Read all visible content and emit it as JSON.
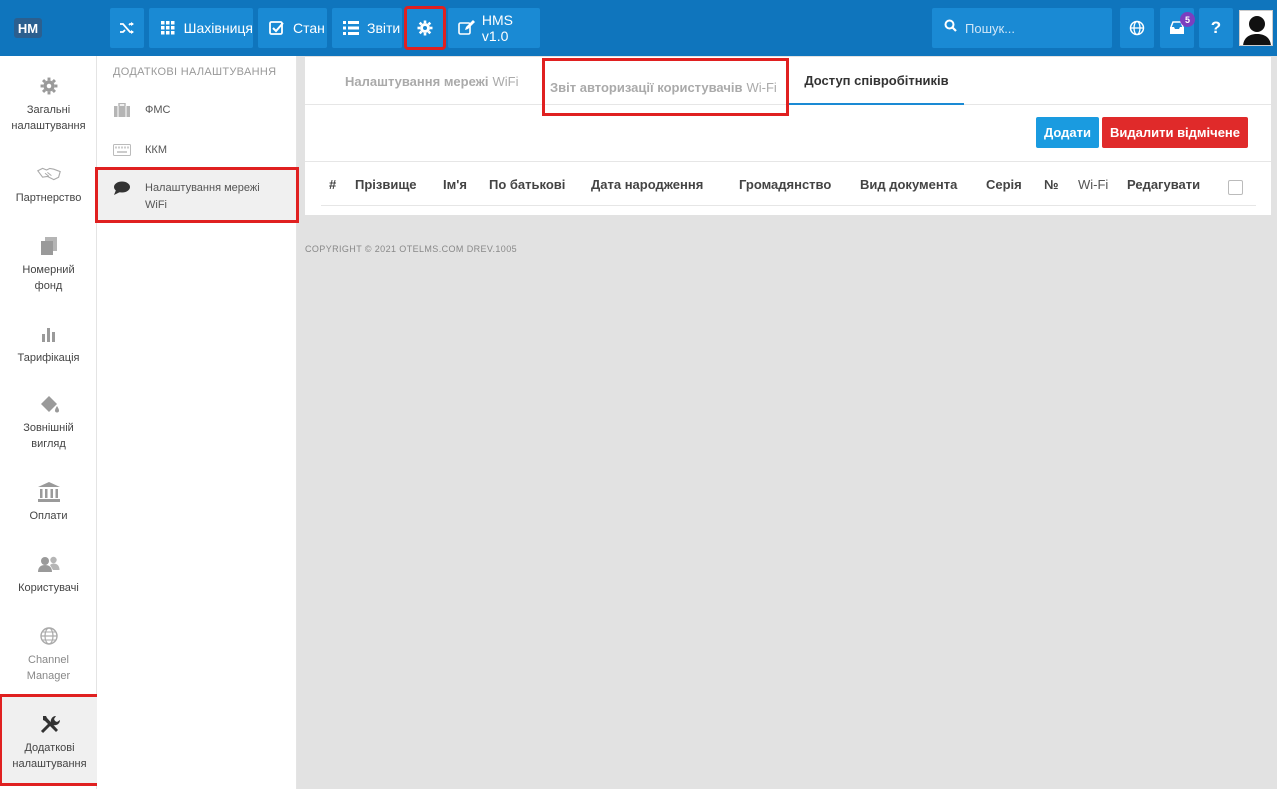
{
  "topbar": {
    "logo_text": "HM",
    "buttons": [
      {
        "icon": "shuffle-icon",
        "label": ""
      },
      {
        "icon": "grid-icon",
        "label": "Шахівниця"
      },
      {
        "icon": "checkbox-icon",
        "label": "Стан"
      },
      {
        "icon": "list-icon",
        "label": "Звіти"
      },
      {
        "icon": "gear-icon",
        "label": ""
      },
      {
        "icon": "edit-icon",
        "label": "HMS v1.0"
      }
    ],
    "search_placeholder": "Пошук...",
    "notification_count": "5",
    "help_label": "?"
  },
  "leftnav": {
    "items": [
      {
        "icon": "gear-icon",
        "label": "Загальні налаштування"
      },
      {
        "icon": "handshake-icon",
        "label": "Партнерство"
      },
      {
        "icon": "copy-icon",
        "label": "Номерний фонд"
      },
      {
        "icon": "bar-chart-icon",
        "label": "Тарифікація"
      },
      {
        "icon": "paint-bucket-icon",
        "label": "Зовнішній вигляд"
      },
      {
        "icon": "bank-icon",
        "label": "Оплати"
      },
      {
        "icon": "users-icon",
        "label": "Користувачі"
      },
      {
        "icon": "globe-icon",
        "label": "Channel Manager"
      },
      {
        "icon": "tools-icon",
        "label": "Додаткові налаштування"
      }
    ]
  },
  "subnav": {
    "title": "ДОДАТКОВІ НАЛАШТУВАННЯ",
    "items": [
      {
        "icon": "briefcase-icon",
        "label": "ФМС"
      },
      {
        "icon": "keyboard-icon",
        "label": "ККМ"
      },
      {
        "icon": "chat-icon",
        "label": "Налаштування мережі WiFi"
      }
    ]
  },
  "tabs": [
    {
      "label": "Налаштування мережі",
      "sub": "WiFi"
    },
    {
      "label": "Звіт авторизації користувачів",
      "sub": "Wi-Fi"
    },
    {
      "label": "Доступ співробітників",
      "sub": ""
    }
  ],
  "actions": {
    "add_label": "Додати",
    "delete_label": "Видалити відмічене"
  },
  "table": {
    "columns": [
      "#",
      "Прізвище",
      "Ім'я",
      "По батькові",
      "Дата народження",
      "Громадянство",
      "Вид документа",
      "Серія",
      "№",
      "Wi-Fi",
      "Редагувати"
    ]
  },
  "footer": {
    "copyright": "COPYRIGHT © 2021 OTELMS.COM DREV.1005"
  },
  "colors": {
    "topbar": "#0f75bd",
    "button": "#1a8ad4",
    "primary": "#1a9be0",
    "danger": "#e02a2a",
    "highlight": "#e02020"
  }
}
